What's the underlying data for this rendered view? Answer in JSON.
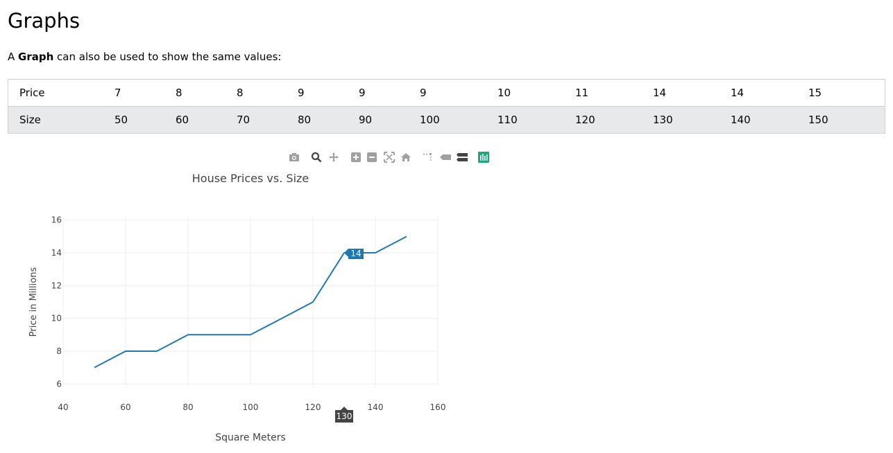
{
  "page": {
    "heading": "Graphs",
    "intro_prefix": "A ",
    "intro_bold": "Graph",
    "intro_suffix": " can also be used to show the same values:"
  },
  "table": {
    "rows": [
      {
        "label": "Price",
        "values": [
          "7",
          "8",
          "8",
          "9",
          "9",
          "9",
          "10",
          "11",
          "14",
          "14",
          "15"
        ]
      },
      {
        "label": "Size",
        "values": [
          "50",
          "60",
          "70",
          "80",
          "90",
          "100",
          "110",
          "120",
          "130",
          "140",
          "150"
        ]
      }
    ]
  },
  "toolbar": {
    "icons": [
      "camera-icon",
      "zoom-icon",
      "pan-icon",
      "zoom-in-icon",
      "zoom-out-icon",
      "autoscale-icon",
      "home-icon",
      "spike-lines-icon",
      "hover-closest-icon",
      "hover-compare-icon",
      "plotly-logo-icon"
    ]
  },
  "chart_data": {
    "type": "line",
    "title": "House Prices vs. Size",
    "xlabel": "Square Meters",
    "ylabel": "Price in Millions",
    "x": [
      50,
      60,
      70,
      80,
      90,
      100,
      110,
      120,
      130,
      140,
      150
    ],
    "series": [
      {
        "values": [
          7,
          8,
          8,
          9,
          9,
          9,
          10,
          11,
          14,
          14,
          15
        ],
        "color": "#1f77b4"
      }
    ],
    "xlim": [
      40,
      160
    ],
    "ylim": [
      5.8,
      16.2
    ],
    "xticks": [
      40,
      60,
      80,
      100,
      120,
      140,
      160
    ],
    "yticks": [
      6,
      8,
      10,
      12,
      14,
      16
    ],
    "grid": true,
    "hover": {
      "x": 130,
      "y": 14,
      "x_label": "130",
      "y_label": "14"
    }
  }
}
